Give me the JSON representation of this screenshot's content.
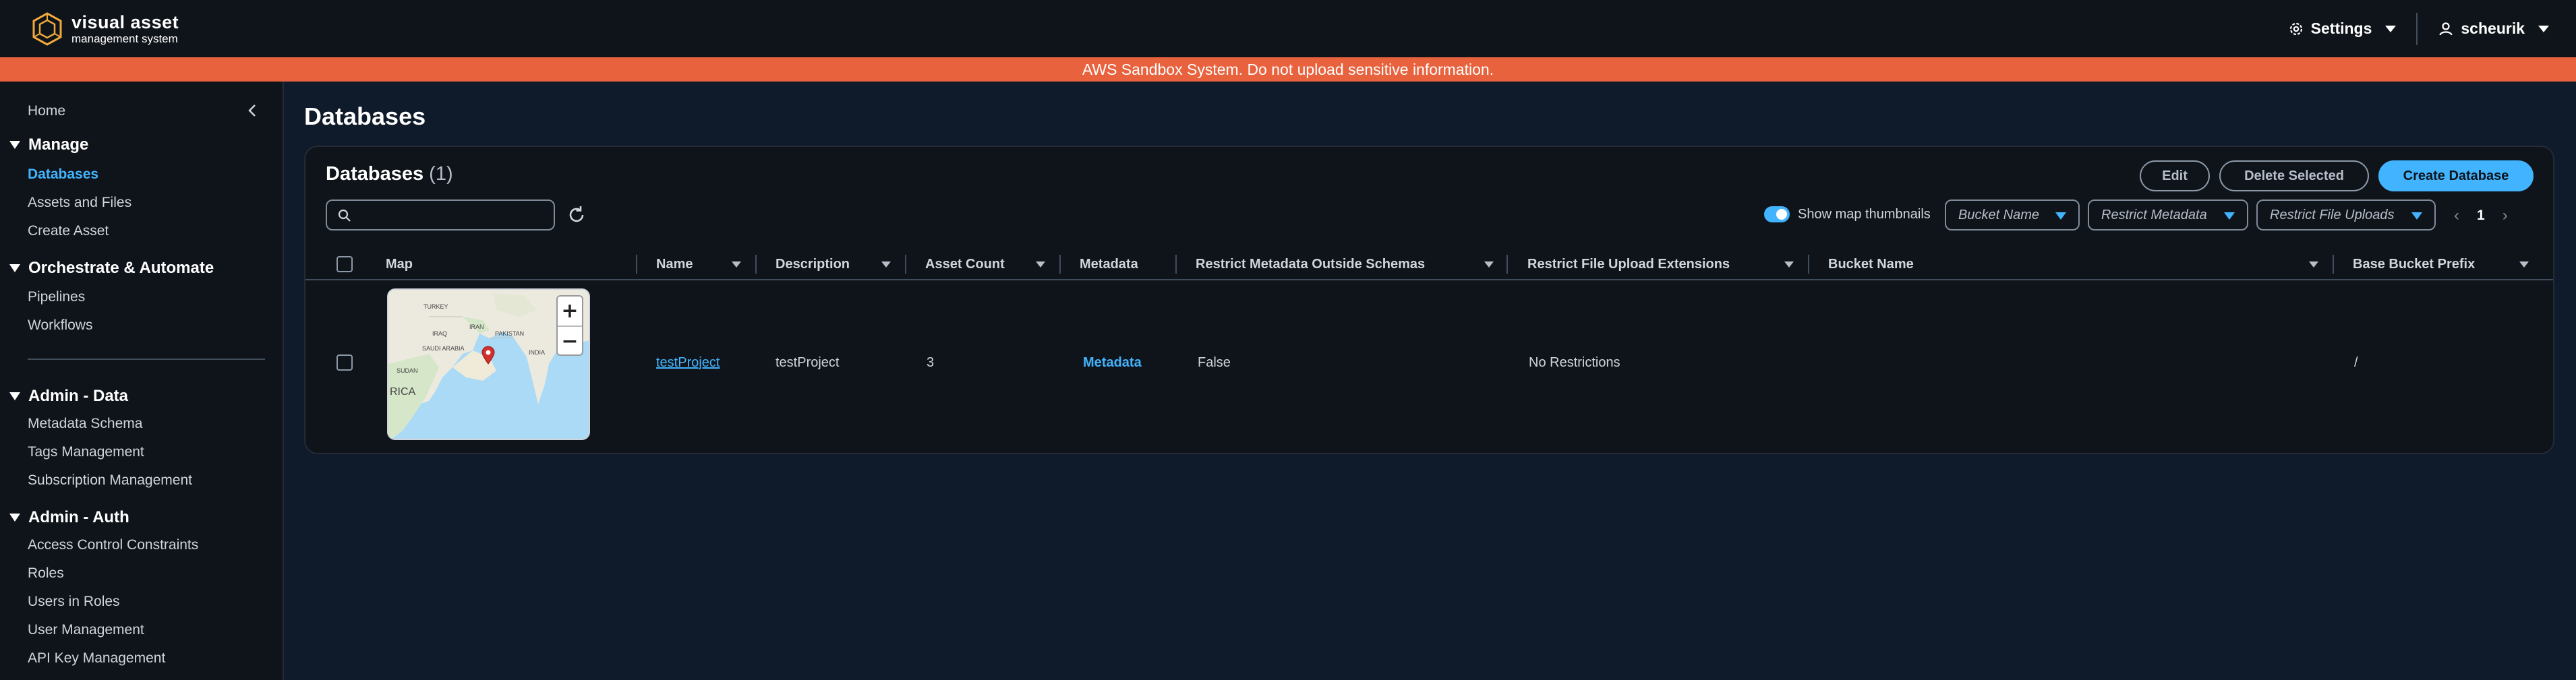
{
  "header": {
    "logo": {
      "line1": "visual asset",
      "line2": "management system"
    },
    "settings_label": "Settings",
    "user_label": "scheurik"
  },
  "banner": {
    "text": "AWS Sandbox System. Do not upload sensitive information.",
    "color": "#e8623e"
  },
  "sidebar": {
    "home": "Home",
    "sections": [
      {
        "title": "Manage",
        "items": [
          "Databases",
          "Assets and Files",
          "Create Asset"
        ]
      },
      {
        "title": "Orchestrate & Automate",
        "items": [
          "Pipelines",
          "Workflows"
        ]
      },
      {
        "title": "Admin - Data",
        "items": [
          "Metadata Schema",
          "Tags Management",
          "Subscription Management"
        ]
      },
      {
        "title": "Admin - Auth",
        "items": [
          "Access Control Constraints",
          "Roles",
          "Users in Roles",
          "User Management",
          "API Key Management"
        ]
      }
    ],
    "active_item": "Databases"
  },
  "page": {
    "title": "Databases"
  },
  "panel": {
    "title": "Databases",
    "count": "(1)",
    "buttons": {
      "edit": "Edit",
      "delete": "Delete Selected",
      "create": "Create Database"
    },
    "search": {
      "placeholder": "",
      "value": ""
    },
    "toggle_label": "Show map thumbnails",
    "toggle_on": true,
    "filters": {
      "bucket": "Bucket Name",
      "restrict_metadata": "Restrict Metadata",
      "restrict_uploads": "Restrict File Uploads"
    },
    "page_number": "1",
    "columns": {
      "map": "Map",
      "name": "Name",
      "description": "Description",
      "asset_count": "Asset Count",
      "metadata": "Metadata",
      "restrict_metadata": "Restrict Metadata Outside Schemas",
      "restrict_uploads": "Restrict File Upload Extensions",
      "bucket_name": "Bucket Name",
      "base_prefix": "Base Bucket Prefix"
    },
    "rows": [
      {
        "name": "testProject",
        "description": "testProject",
        "asset_count": "3",
        "metadata": "Metadata",
        "restrict_metadata": "False",
        "restrict_uploads": "No Restrictions",
        "bucket_name": "",
        "base_prefix": "/",
        "map_labels": [
          "TURKEY",
          "IRAN",
          "IRAQ",
          "SAUDI ARABIA",
          "PAKISTAN",
          "INDIA",
          "SUDAN",
          "RICA"
        ],
        "map_zoom": {
          "in": "+",
          "out": "−"
        }
      }
    ]
  },
  "colors": {
    "accent": "#42b4ff",
    "background": "#0f141a",
    "page_bg": "#0f1b2a"
  }
}
